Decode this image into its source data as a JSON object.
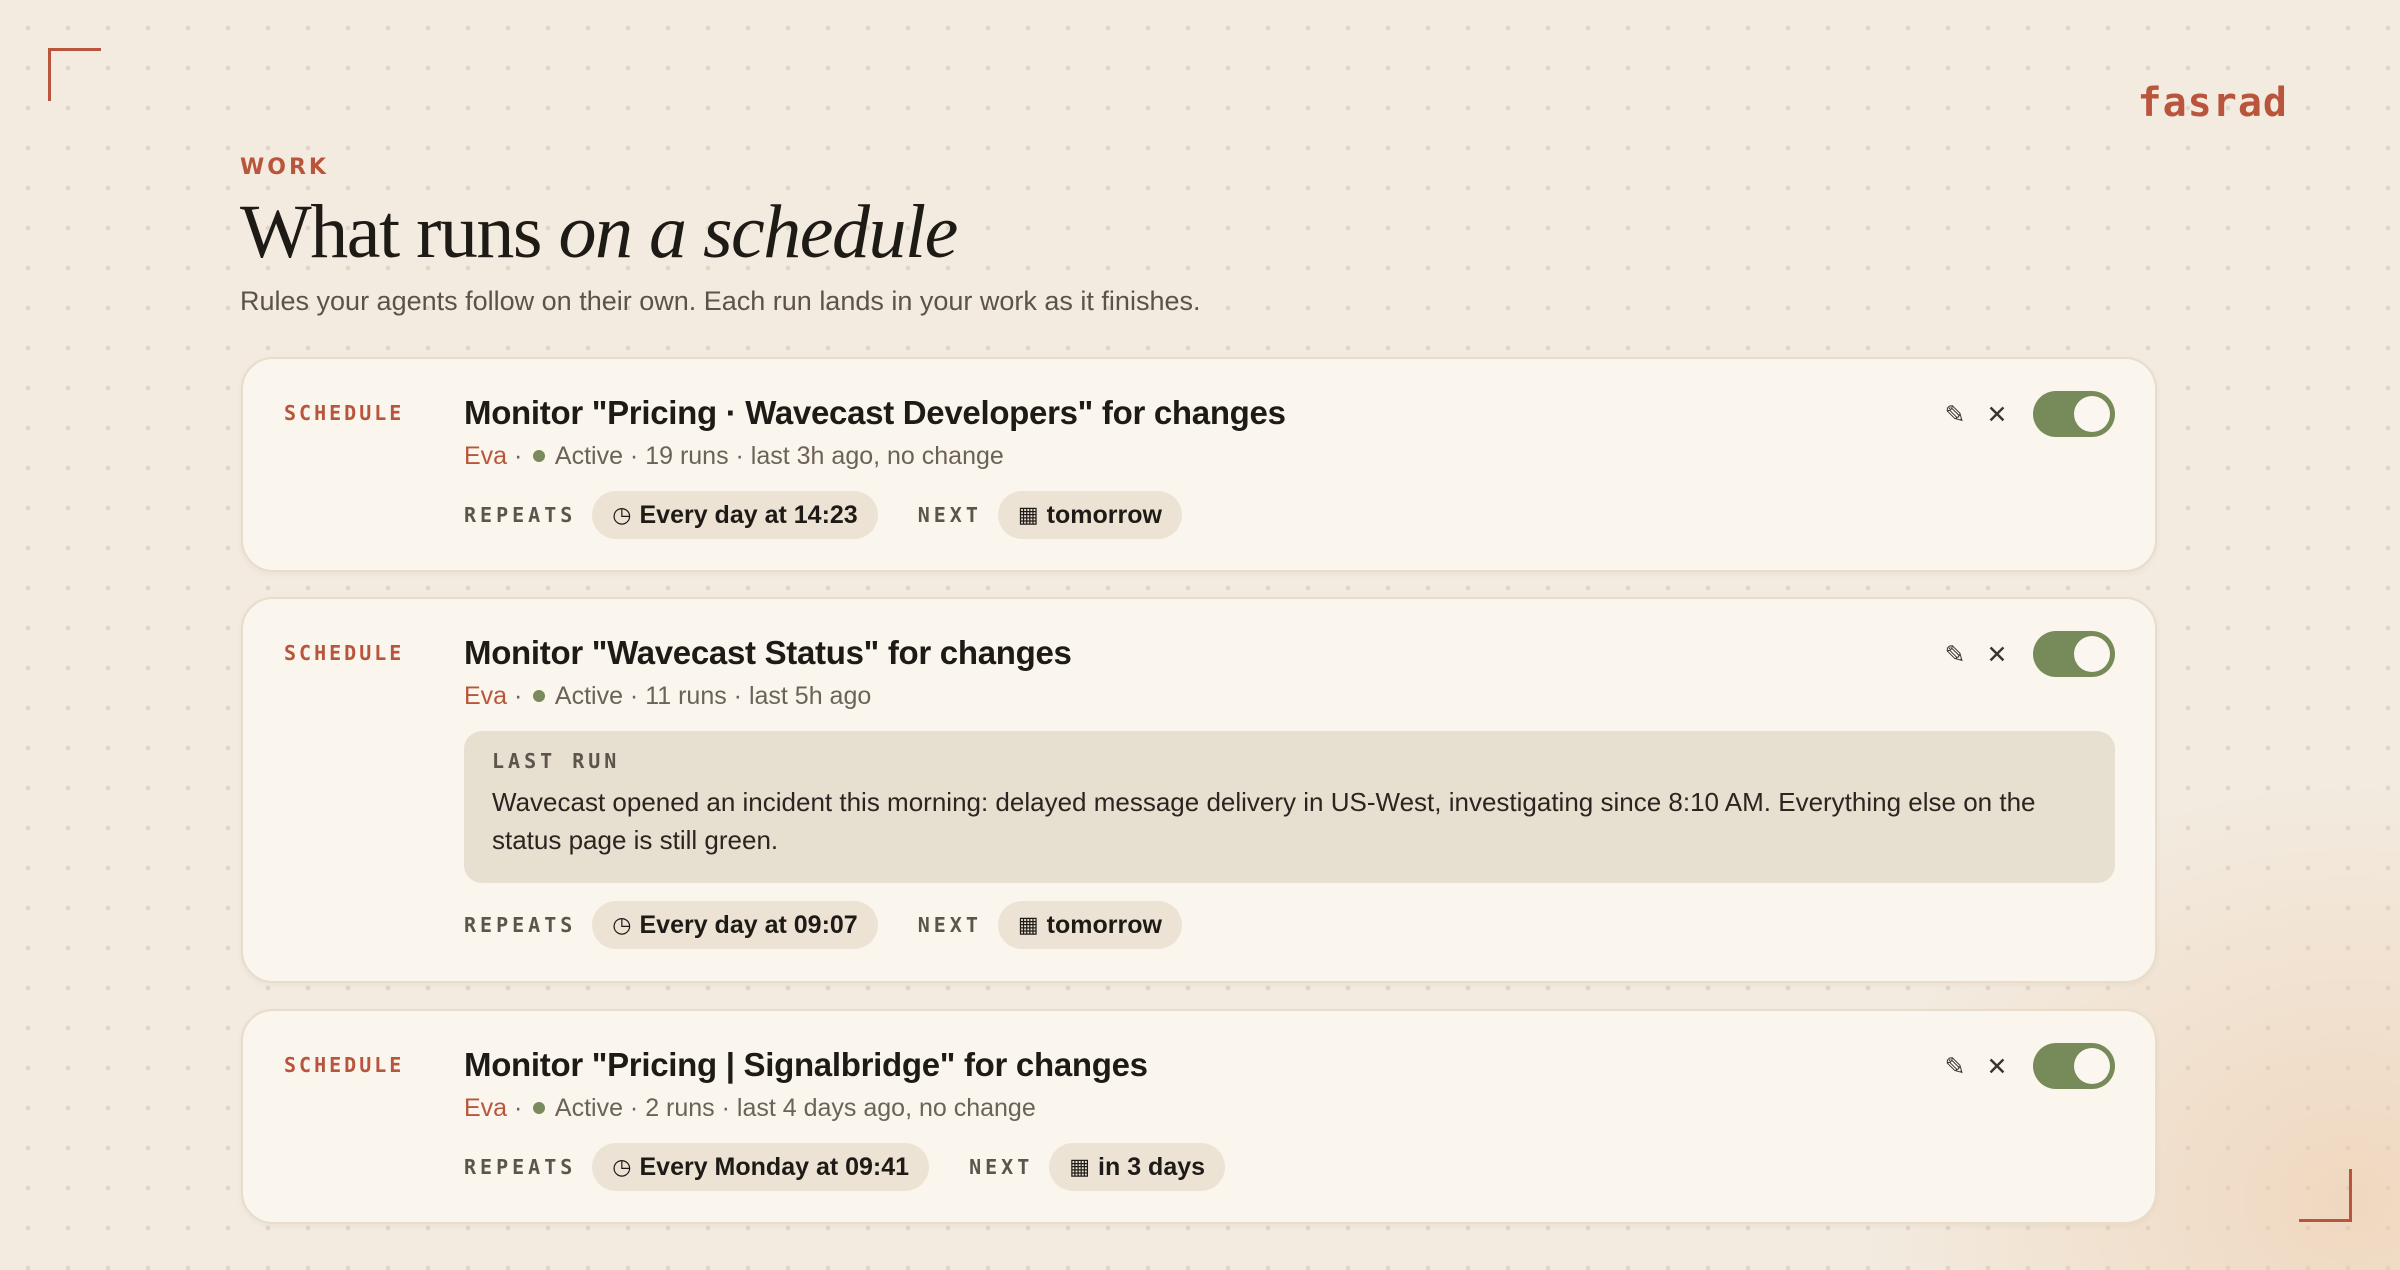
{
  "brand": "fasrad",
  "header": {
    "eyebrow": "WORK",
    "title_plain": "What runs ",
    "title_italic": "on a schedule",
    "subtitle": "Rules your agents follow on their own. Each run lands in your work as it finishes."
  },
  "labels": {
    "kicker": "SCHEDULE",
    "repeats": "REPEATS",
    "next": "NEXT",
    "last_run": "LAST RUN"
  },
  "icons": {
    "edit": "pencil-icon",
    "delete": "close-icon",
    "clock": "clock-icon",
    "calendar": "calendar-icon"
  },
  "colors": {
    "accent": "#b9553c",
    "active_dot": "#7a8a5c",
    "toggle_on": "#778a5a",
    "background": "#f3ebe0",
    "card": "#faf5ed"
  },
  "schedules": [
    {
      "title": "Monitor \"Pricing · Wavecast Developers\" for changes",
      "owner": "Eva",
      "status": "Active",
      "details": "19 runs · last 3h ago, no change",
      "repeats": "Every day at 14:23",
      "next": "tomorrow",
      "enabled": true
    },
    {
      "title": "Monitor \"Wavecast Status\" for changes",
      "owner": "Eva",
      "status": "Active",
      "details": "11 runs · last 5h ago",
      "last_run_text": "Wavecast opened an incident this morning: delayed message delivery in US-West, investigating since 8:10 AM. Everything else on the status page is still green.",
      "repeats": "Every day at 09:07",
      "next": "tomorrow",
      "enabled": true
    },
    {
      "title": "Monitor \"Pricing | Signalbridge\" for changes",
      "owner": "Eva",
      "status": "Active",
      "details": "2 runs · last 4 days ago, no change",
      "repeats": "Every Monday at 09:41",
      "next": "in 3 days",
      "enabled": true
    }
  ]
}
